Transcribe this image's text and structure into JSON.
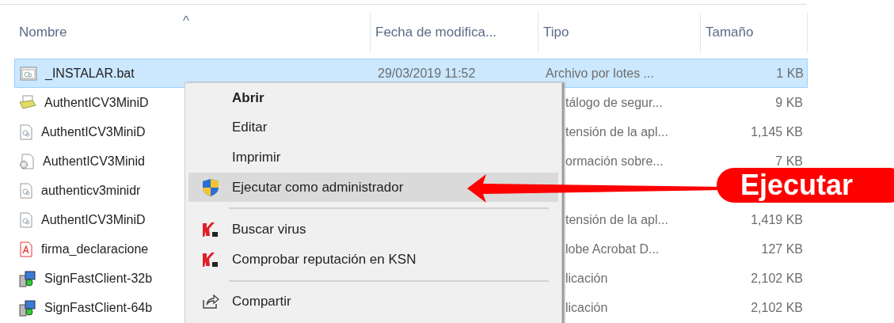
{
  "columns": [
    {
      "label": "Nombre",
      "sort_indicator": "^"
    },
    {
      "label": "Fecha de modifica..."
    },
    {
      "label": "Tipo"
    },
    {
      "label": "Tamaño"
    }
  ],
  "files": [
    {
      "name": "_INSTALAR.bat",
      "date": "29/03/2019 11:52",
      "type": "Archivo por lotes ...",
      "size": "1 KB",
      "kind": "batch",
      "selected": true
    },
    {
      "name": "AuthentICV3MiniD",
      "type": "tálogo de segur...",
      "size": "9 KB",
      "kind": "catalog",
      "selected": false
    },
    {
      "name": "AuthentICV3MiniD",
      "type": "tensión de la apl...",
      "size": "1,145 KB",
      "kind": "document",
      "selected": false
    },
    {
      "name": "AuthentICV3Minid",
      "type": "ormación sobre...",
      "size": "7 KB",
      "kind": "settings",
      "selected": false
    },
    {
      "name": "authenticv3minidr",
      "kind": "document",
      "selected": false
    },
    {
      "name": "AuthentICV3MiniD",
      "type": "tensión de la apl...",
      "size": "1,419 KB",
      "kind": "document",
      "selected": false
    },
    {
      "name": "firma_declaracione",
      "type": "lobe Acrobat D...",
      "size": "127 KB",
      "kind": "pdf",
      "selected": false
    },
    {
      "name": "SignFastClient-32b",
      "type": "licación",
      "size": "2,102 KB",
      "kind": "installer",
      "selected": false
    },
    {
      "name": "SignFastClient-64b",
      "type": "licación",
      "size": "2,102 KB",
      "kind": "installer",
      "selected": false
    }
  ],
  "context_menu": {
    "items": [
      {
        "kind": "plain",
        "label": "Abrir",
        "default": true,
        "highlighted": false
      },
      {
        "kind": "plain",
        "label": "Editar",
        "default": false,
        "highlighted": false
      },
      {
        "kind": "plain",
        "label": "Imprimir",
        "default": false,
        "highlighted": false
      },
      {
        "kind": "shield",
        "label": "Ejecutar como administrador",
        "default": false,
        "highlighted": true
      },
      {
        "kind": "separator"
      },
      {
        "kind": "antivirus",
        "label": "Buscar virus",
        "default": false,
        "highlighted": false
      },
      {
        "kind": "antivirus",
        "label": "Comprobar reputación en KSN",
        "default": false,
        "highlighted": false
      },
      {
        "kind": "separator"
      },
      {
        "kind": "share",
        "label": "Compartir",
        "default": false,
        "highlighted": false
      }
    ]
  },
  "callout": {
    "label": "Ejecutar"
  }
}
